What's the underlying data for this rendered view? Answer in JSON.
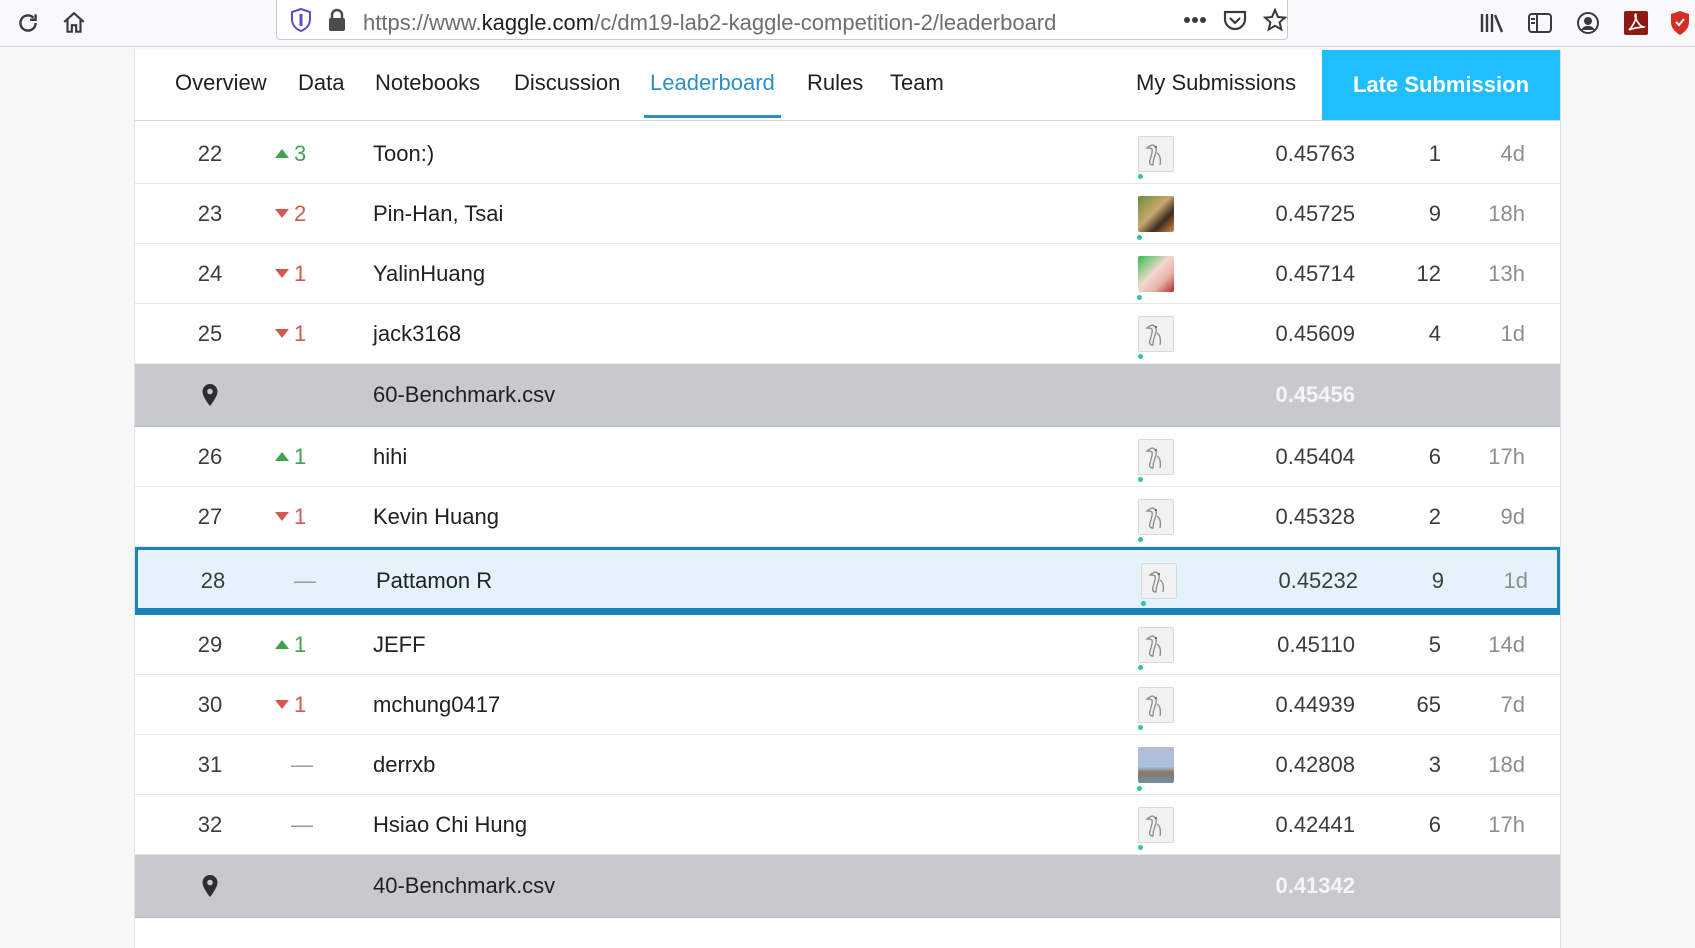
{
  "browser": {
    "url_prefix": "https://www.",
    "url_domain": "kaggle.com",
    "url_path": "/c/dm19-lab2-kaggle-competition-2/leaderboard",
    "icons": [
      "reload-icon",
      "home-icon",
      "shield-icon",
      "lock-icon",
      "more-icon",
      "pocket-icon",
      "star-icon",
      "library-icon",
      "sidebar-icon",
      "account-icon",
      "pdf-icon",
      "extension-shield-icon"
    ]
  },
  "tabs": {
    "overview": "Overview",
    "data": "Data",
    "notebooks": "Notebooks",
    "discussion": "Discussion",
    "leaderboard": "Leaderboard",
    "rules": "Rules",
    "team": "Team",
    "my_submissions": "My Submissions",
    "late_submission": "Late Submission",
    "active": "Leaderboard"
  },
  "colors": {
    "accent": "#20beff",
    "tab_active": "#2b90c7",
    "up": "#3fa34d",
    "down": "#d15a4e",
    "highlight_border": "#1b84b9",
    "benchmark_bg": "#c6c9cd"
  },
  "rows": [
    {
      "rank": "22",
      "change": "3",
      "dir": "up",
      "name": "Toon:)",
      "avatar": "default",
      "score": "0.45763",
      "entries": "1",
      "last": "4d"
    },
    {
      "rank": "23",
      "change": "2",
      "dir": "down",
      "name": "Pin-Han, Tsai",
      "avatar": "photo1",
      "score": "0.45725",
      "entries": "9",
      "last": "18h"
    },
    {
      "rank": "24",
      "change": "1",
      "dir": "down",
      "name": "YalinHuang",
      "avatar": "photo2",
      "score": "0.45714",
      "entries": "12",
      "last": "13h"
    },
    {
      "rank": "25",
      "change": "1",
      "dir": "down",
      "name": "jack3168",
      "avatar": "default",
      "score": "0.45609",
      "entries": "4",
      "last": "1d"
    },
    {
      "benchmark": true,
      "name": "60-Benchmark.csv",
      "score": "0.45456"
    },
    {
      "rank": "26",
      "change": "1",
      "dir": "up",
      "name": "hihi",
      "avatar": "default",
      "score": "0.45404",
      "entries": "6",
      "last": "17h"
    },
    {
      "rank": "27",
      "change": "1",
      "dir": "down",
      "name": "Kevin Huang",
      "avatar": "default",
      "score": "0.45328",
      "entries": "2",
      "last": "9d"
    },
    {
      "rank": "28",
      "change": "—",
      "dir": "none",
      "name": "Pattamon R",
      "avatar": "default",
      "score": "0.45232",
      "entries": "9",
      "last": "1d",
      "highlight": true
    },
    {
      "rank": "29",
      "change": "1",
      "dir": "up",
      "name": "JEFF",
      "avatar": "default",
      "score": "0.45110",
      "entries": "5",
      "last": "14d"
    },
    {
      "rank": "30",
      "change": "1",
      "dir": "down",
      "name": "mchung0417",
      "avatar": "default",
      "score": "0.44939",
      "entries": "65",
      "last": "7d"
    },
    {
      "rank": "31",
      "change": "—",
      "dir": "none",
      "name": "derrxb",
      "avatar": "photo3",
      "score": "0.42808",
      "entries": "3",
      "last": "18d"
    },
    {
      "rank": "32",
      "change": "—",
      "dir": "none",
      "name": "Hsiao Chi Hung",
      "avatar": "default",
      "score": "0.42441",
      "entries": "6",
      "last": "17h"
    },
    {
      "benchmark": true,
      "name": "40-Benchmark.csv",
      "score": "0.41342"
    }
  ]
}
